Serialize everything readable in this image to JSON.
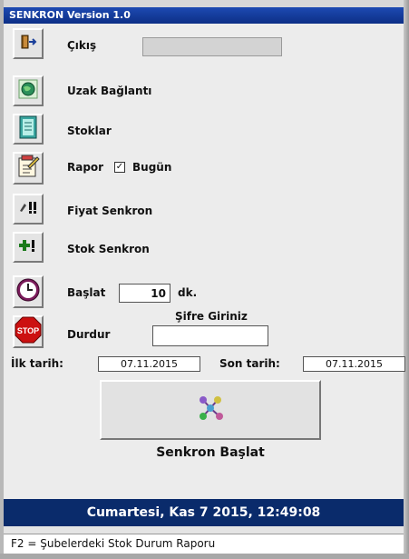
{
  "window": {
    "title": "SENKRON Version 1.0"
  },
  "menu": {
    "exit_label": "Çıkış",
    "remote_label": "Uzak Bağlantı",
    "stocks_label": "Stoklar",
    "report_label": "Rapor",
    "today_label": "Bugün",
    "today_checked": true,
    "price_sync_label": "Fiyat Senkron",
    "stock_sync_label": "Stok Senkron",
    "start_label": "Başlat",
    "interval_value": "10",
    "interval_unit": "dk.",
    "stop_label": "Durdur",
    "password_caption": "Şifre Giriniz",
    "password_value": "",
    "exit_field_value": ""
  },
  "dates": {
    "first_label": "İlk tarih:",
    "first_value": "07.11.2015",
    "last_label": "Son tarih:",
    "last_value": "07.11.2015"
  },
  "sync_button": {
    "label": "Senkron Başlat"
  },
  "footer": {
    "datetime": "Cumartesi, Kas 7 2015, 12:49:08",
    "status": "F2 = Şubelerdeki Stok Durum Raporu"
  },
  "icons": {
    "exit": "exit-door-icon",
    "remote": "globe-icon",
    "stocks": "notebook-icon",
    "report": "report-icon",
    "price_sync": "price-sync-icon",
    "stock_sync": "stock-sync-icon",
    "start": "clock-icon",
    "stop": "stop-sign-icon",
    "sync": "molecule-sync-icon"
  },
  "colors": {
    "title_bar": "#0d2f86",
    "footer_bar": "#0a2b6b",
    "stop_red": "#cc1010"
  }
}
